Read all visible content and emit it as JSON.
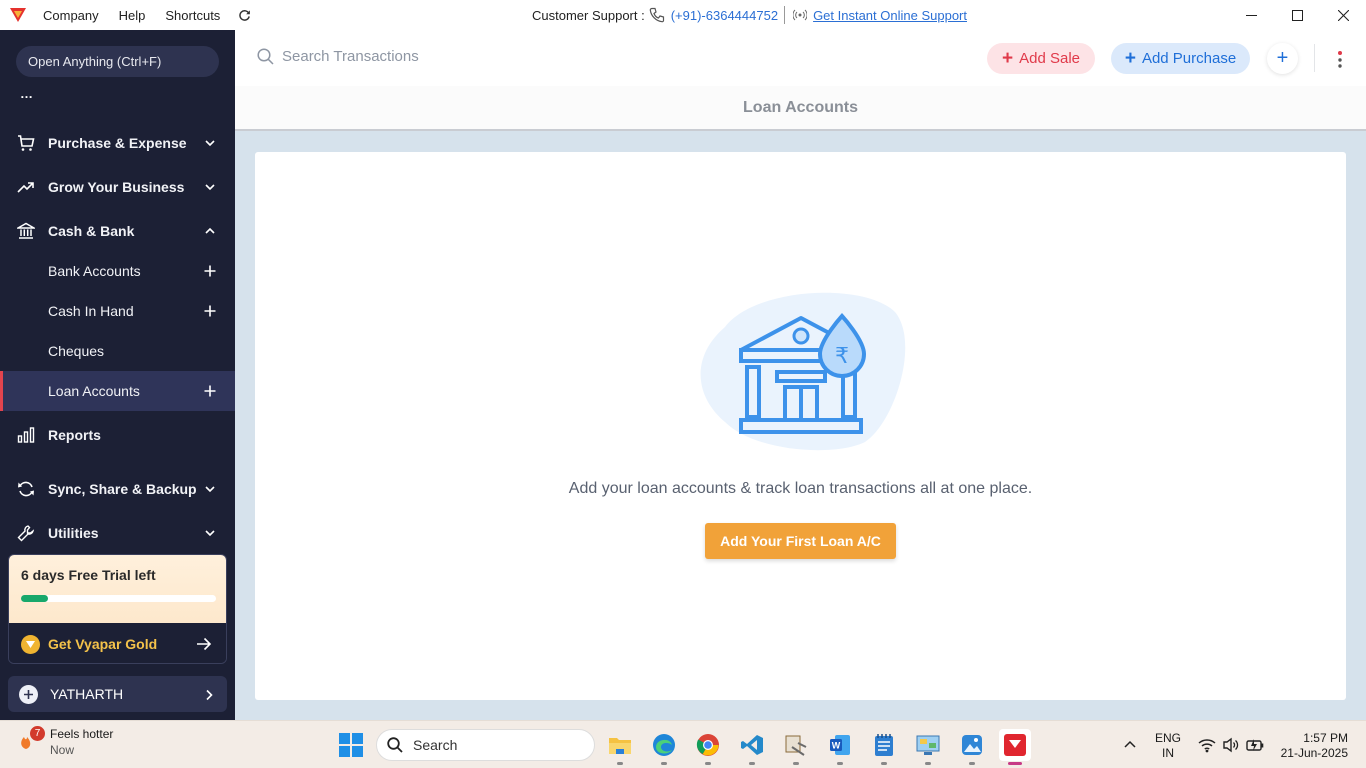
{
  "titlebar": {
    "menu": [
      "Company",
      "Help",
      "Shortcuts"
    ],
    "support_label": "Customer Support :",
    "support_phone": "(+91)-6364444752",
    "online_support": "Get Instant Online Support"
  },
  "sidebar": {
    "open_anything": "Open Anything (Ctrl+F)",
    "ellipsis": "…",
    "items": {
      "purchase": "Purchase & Expense",
      "grow": "Grow Your Business",
      "cash_bank": "Cash & Bank",
      "bank_accounts": "Bank Accounts",
      "cash_in_hand": "Cash In Hand",
      "cheques": "Cheques",
      "loan_accounts": "Loan Accounts",
      "reports": "Reports",
      "sync": "Sync, Share & Backup",
      "utilities": "Utilities"
    },
    "trial": {
      "text": "6 days Free Trial left",
      "progress_fraction": 0.14,
      "gold_label": "Get Vyapar Gold"
    },
    "company_name": "YATHARTH"
  },
  "toolbar": {
    "search_placeholder": "Search Transactions",
    "add_sale": "Add Sale",
    "add_purchase": "Add Purchase"
  },
  "page": {
    "title": "Loan Accounts",
    "empty_message": "Add your loan accounts & track loan transactions all at one place.",
    "cta_label": "Add Your First Loan A/C",
    "currency_symbol": "₹"
  },
  "taskbar": {
    "weather_title": "Feels hotter",
    "weather_sub": "Now",
    "weather_badge": "7",
    "search_label": "Search",
    "lang_top": "ENG",
    "lang_bottom": "IN",
    "time": "1:57 PM",
    "date": "21-Jun-2025"
  },
  "colors": {
    "sidebar_bg": "#1c2035",
    "accent_red": "#e03a4a",
    "accent_blue": "#1f6fd8",
    "cta_orange": "#f1a239",
    "trial_green": "#18a86b",
    "gold": "#f4c24a"
  }
}
